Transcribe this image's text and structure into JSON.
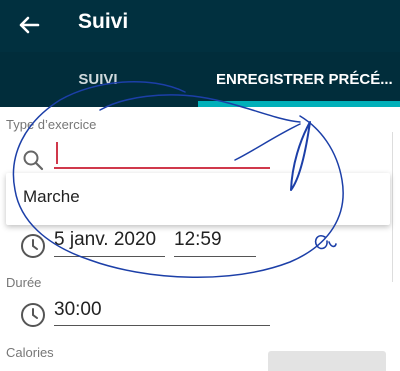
{
  "appbar": {
    "title": "Suivi",
    "back_icon": "arrow-left-icon"
  },
  "tabs": [
    {
      "label": "SUIVI"
    },
    {
      "label": "ENREGISTRER PRÉCÉ..."
    }
  ],
  "form": {
    "exercise_type": {
      "label": "Type d’exercice",
      "value": "",
      "icon": "search-icon"
    },
    "suggestions": [
      "Marche"
    ],
    "date": "5 janv. 2020",
    "time": "12:59",
    "duration": {
      "label": "Durée",
      "value": "30:00"
    },
    "calories": {
      "label": "Calories"
    }
  },
  "colors": {
    "appbar": "#01303f",
    "tab_indicator": "#00b0b9",
    "input_focus": "#d0384b",
    "ink": "#1c3fa8"
  }
}
